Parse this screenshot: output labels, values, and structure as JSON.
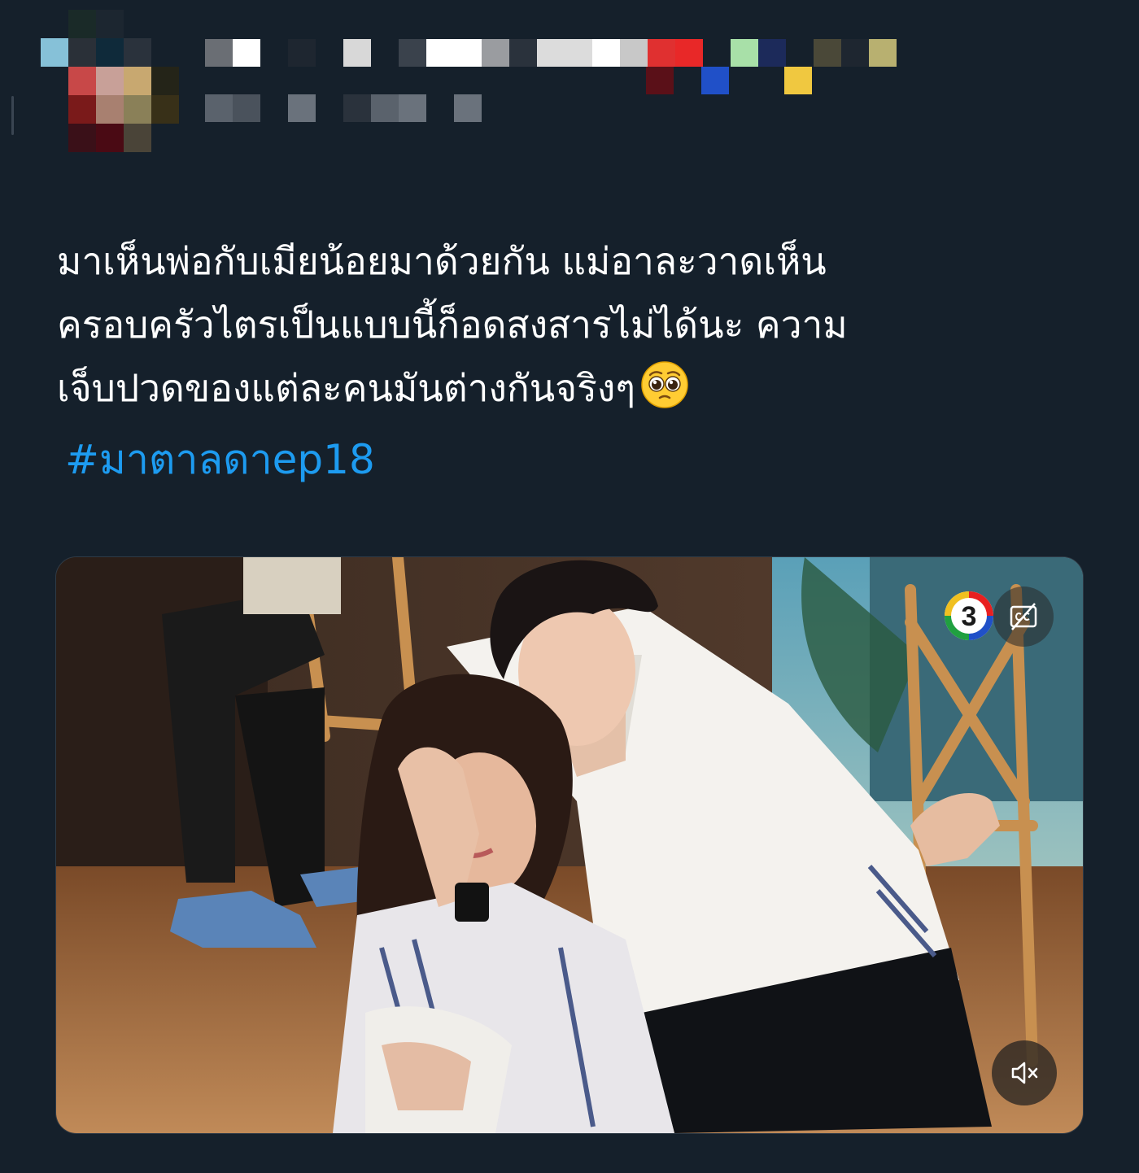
{
  "tweet": {
    "lines": [
      "มาเห็นพ่อกับเมียน้อยมาด้วยกัน แม่อาละวาดเห็น",
      "ครอบครัวไตรเป็นแบบนี้ก็อดสงสารไม่ได้นะ ความ",
      "เจ็บปวดของแต่ละคนมันต่างกันจริงๆ"
    ],
    "emoji": "pleading-face",
    "hashtag": "#มาตาลดาep18"
  },
  "media": {
    "type": "video",
    "channel_logo": "channel-3-logo",
    "channel_logo_text": "3",
    "cc_icon": "closed-captions-off-icon",
    "mute_icon": "speaker-muted-icon"
  },
  "colors": {
    "background": "#15202b",
    "text": "#ffffff",
    "hashtag": "#1d9bf0"
  }
}
